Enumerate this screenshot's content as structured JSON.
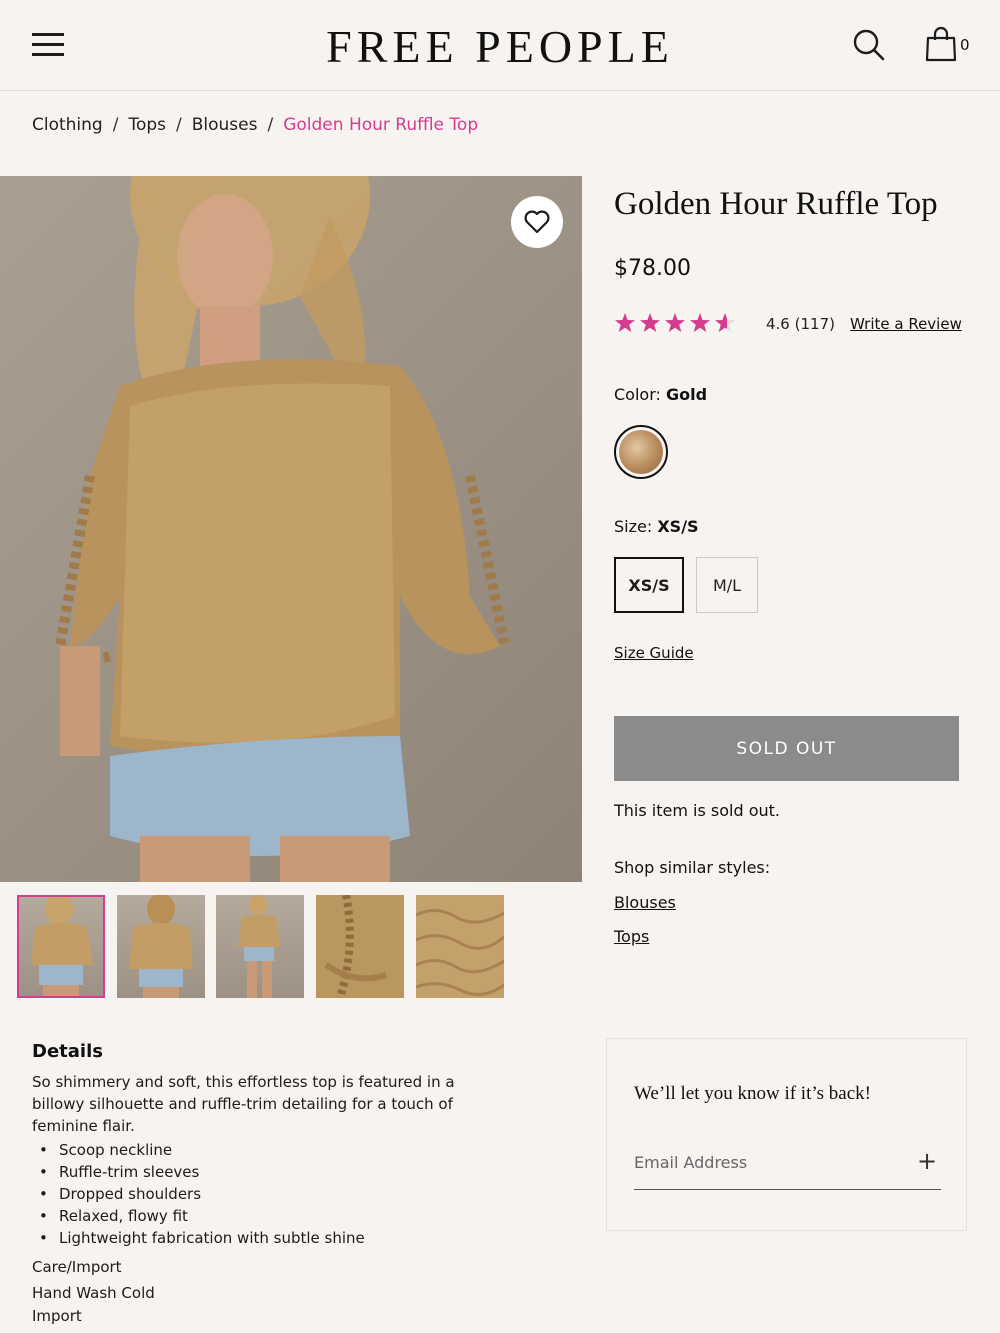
{
  "header": {
    "logo": "FREE PEOPLE",
    "bag_count": "0",
    "icons": [
      "hamburger-menu-icon",
      "search-icon",
      "shopping-bag-icon"
    ]
  },
  "breadcrumb": {
    "items": [
      "Clothing",
      "Tops",
      "Blouses"
    ],
    "current": "Golden Hour Ruffle Top",
    "separator": "/"
  },
  "product": {
    "title": "Golden Hour Ruffle Top",
    "price": "$78.00",
    "rating": 4.6,
    "rating_label": "4.6",
    "review_count": "(117)",
    "write_review": "Write a Review",
    "color_label": "Color:",
    "color_value": "Gold",
    "size_label": "Size:",
    "size_value": "XS/S",
    "sizes": [
      "XS/S",
      "M/L"
    ],
    "size_guide": "Size Guide",
    "sold_out_button": "SOLD OUT",
    "sold_out_message": "This item is sold out.",
    "similar_label": "Shop similar styles:",
    "similar_links": [
      "Blouses",
      "Tops"
    ]
  },
  "details": {
    "title": "Details",
    "description": "So shimmery and soft, this effortless top is featured in a billowy silhouette and ruffle-trim detailing for a touch of feminine flair.",
    "features": [
      "Scoop neckline",
      "Ruffle-trim sleeves",
      "Dropped shoulders",
      "Relaxed, flowy fit",
      "Lightweight fabrication with subtle shine"
    ],
    "care_title": "Care/Import",
    "care": "Hand Wash Cold",
    "import": "Import"
  },
  "notify": {
    "title": "We’ll let you know if it’s back!",
    "email_placeholder": "Email Address",
    "submit_icon": "plus-icon"
  },
  "colors": {
    "accent": "#d43d8f",
    "background": "#f6f3f1",
    "sold_out": "#8b8b8b",
    "text": "#1c1c1c"
  }
}
